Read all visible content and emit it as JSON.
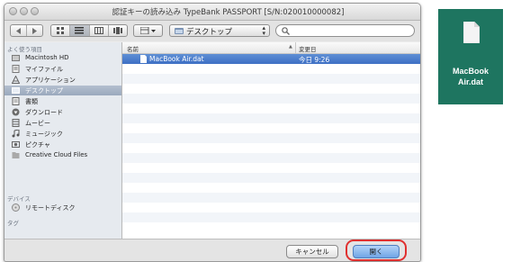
{
  "window": {
    "title": "認証キーの読み込み TypeBank PASSPORT [S/N:020010000082]"
  },
  "toolbar": {
    "location": "デスクトップ",
    "search_placeholder": ""
  },
  "sidebar": {
    "section_favorites": "よく使う項目",
    "favorites": [
      {
        "label": "Macintosh HD",
        "icon": "hard-drive-icon"
      },
      {
        "label": "マイファイル",
        "icon": "all-my-files-icon"
      },
      {
        "label": "アプリケーション",
        "icon": "applications-icon"
      },
      {
        "label": "デスクトップ",
        "icon": "desktop-icon"
      },
      {
        "label": "書類",
        "icon": "documents-icon"
      },
      {
        "label": "ダウンロード",
        "icon": "downloads-icon"
      },
      {
        "label": "ムービー",
        "icon": "movies-icon"
      },
      {
        "label": "ミュージック",
        "icon": "music-icon"
      },
      {
        "label": "ピクチャ",
        "icon": "pictures-icon"
      },
      {
        "label": "Creative Cloud Files",
        "icon": "folder-icon"
      }
    ],
    "section_devices": "デバイス",
    "devices": [
      {
        "label": "リモートディスク",
        "icon": "remote-disc-icon"
      }
    ],
    "section_tags": "タグ"
  },
  "list": {
    "col_name": "名前",
    "col_modified": "変更日",
    "files": [
      {
        "name": "MacBook Air.dat",
        "modified": "今日 9:26"
      }
    ]
  },
  "buttons": {
    "cancel": "キャンセル",
    "open": "開く"
  },
  "desktop_icon": {
    "line1": "MacBook",
    "line2": "Air.dat"
  },
  "colors": {
    "selection": "#3d6fc4",
    "highlight_ring": "#e0302f",
    "desktop": "#1e7560"
  }
}
